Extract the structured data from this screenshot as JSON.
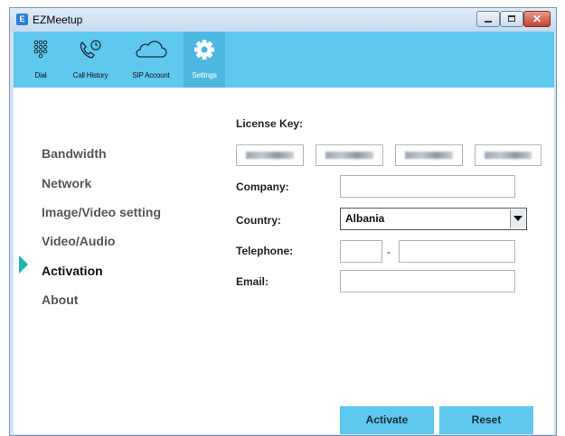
{
  "window": {
    "title": "EZMeetup",
    "app_icon_letter": "E"
  },
  "titlebar_buttons": {
    "close_glyph": "✕"
  },
  "toolbar": {
    "items": [
      {
        "label": "Dial",
        "icon": "dialpad-icon"
      },
      {
        "label": "Call History",
        "icon": "call-history-icon"
      },
      {
        "label": "SIP Account",
        "icon": "cloud-icon"
      },
      {
        "label": "Settings",
        "icon": "gear-icon",
        "selected": true
      }
    ]
  },
  "nav": {
    "items": [
      {
        "label": "Bandwidth"
      },
      {
        "label": "Network"
      },
      {
        "label": "Image/Video setting"
      },
      {
        "label": "Video/Audio"
      },
      {
        "label": "Activation",
        "active": true
      },
      {
        "label": "About"
      }
    ]
  },
  "form": {
    "license_key_label": "License Key:",
    "company_label": "Company:",
    "company_value": "",
    "country_label": "Country:",
    "country_value": "Albania",
    "telephone_label": "Telephone:",
    "telephone_separator": "-",
    "email_label": "Email:",
    "email_value": ""
  },
  "buttons": {
    "activate": "Activate",
    "reset": "Reset"
  },
  "colors": {
    "toolbar": "#5ec8ee",
    "active_marker": "#1fb5b0"
  }
}
